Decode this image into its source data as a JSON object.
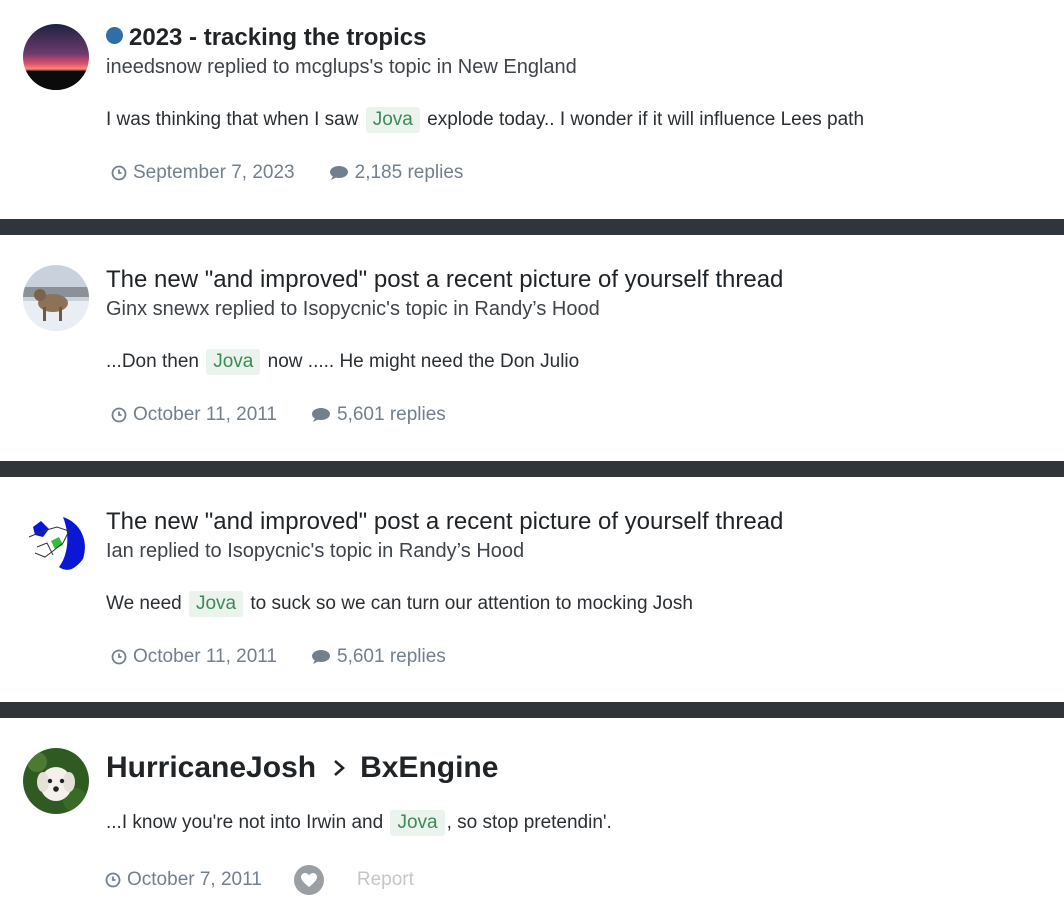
{
  "results": [
    {
      "title": "2023 - tracking the tropics",
      "unread": true,
      "author": "ineedsnow",
      "meta_text": "ineedsnow replied to mcglups's topic in New England",
      "snippet_before": "I was thinking that when I saw",
      "highlight": "Jova",
      "snippet_after": "explode today.. I wonder if it will influence Lees path",
      "date": "September 7, 2023",
      "replies": "2,185 replies"
    },
    {
      "title": "The new \"and improved\" post a recent picture of yourself thread",
      "unread": false,
      "author": "Ginx snewx",
      "meta_text": "Ginx snewx replied to Isopycnic's topic in Randy’s Hood",
      "snippet_before": "...Don then",
      "highlight": "Jova",
      "snippet_after": "now ..... He might need the Don Julio",
      "date": "October 11, 2011",
      "replies": "5,601 replies"
    },
    {
      "title": "The new \"and improved\" post a recent picture of yourself thread",
      "unread": false,
      "author": "Ian",
      "meta_text": "Ian replied to Isopycnic's topic in Randy’s Hood",
      "snippet_before": "We need",
      "highlight": "Jova",
      "snippet_after": "to suck so we can turn our attention to mocking Josh",
      "date": "October 11, 2011",
      "replies": "5,601 replies"
    },
    {
      "from_user": "HurricaneJosh",
      "to_user": "BxEngine",
      "snippet_before": "...I know you're not into Irwin and",
      "highlight": "Jova",
      "snippet_after": ", so stop pretendin'.",
      "date": "October 7, 2011",
      "report_label": "Report"
    }
  ],
  "colors": {
    "unread_dot": "#2f6ea8",
    "highlight_bg": "#eaf3ec",
    "highlight_text": "#3d8a55",
    "separator": "#2f353b",
    "meta_text": "#72808e"
  },
  "icons": {
    "date": "clock-icon",
    "replies": "comment-icon",
    "reaction": "heart-icon",
    "breadcrumb_separator": "chevron-right-icon"
  }
}
